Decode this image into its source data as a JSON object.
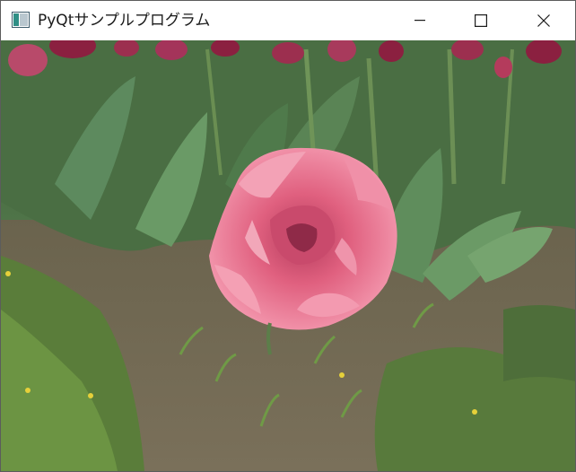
{
  "window": {
    "title": "PyQtサンプルプログラム"
  },
  "titlebar": {
    "icons": [
      "app-window-icon",
      "minimize-icon",
      "maximize-icon",
      "close-icon"
    ]
  },
  "image": {
    "subject": "pink-tulip-photo"
  },
  "colors": {
    "titlebar_bg": "#ffffff",
    "title_text": "#1a1a1a",
    "tulip_pink": "#e86f8e",
    "tulip_dark_red": "#8b2040",
    "leaf_green": "#4b7a4a",
    "soil_brown": "#6e6650",
    "grass_green": "#5d8f3a"
  }
}
